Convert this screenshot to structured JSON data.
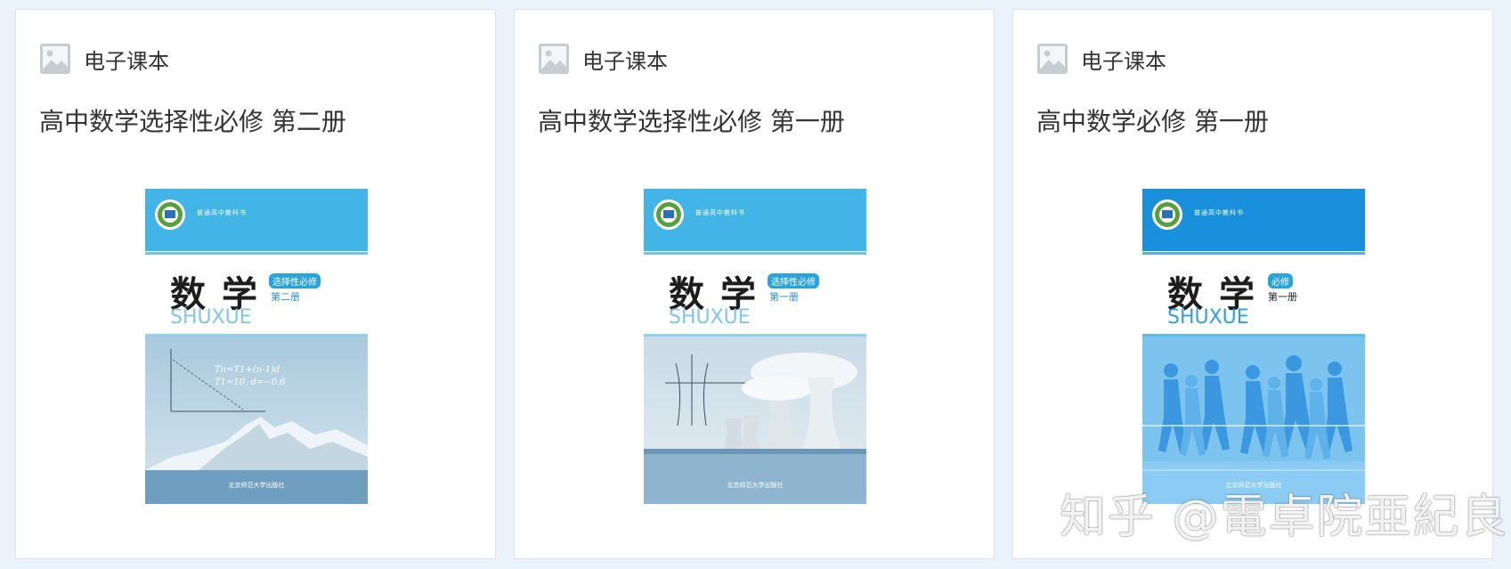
{
  "cards": [
    {
      "type_label": "电子课本",
      "title": "高中数学选择性必修 第二册",
      "cover": {
        "series": "普通高中教科书",
        "subject": "数学",
        "pinyin": "SHUXUE",
        "badge": "选择性必修",
        "volume": "第二册",
        "formula_1": "Tn=T1+(n-1)d",
        "formula_2": "T1=10, d=−0.6",
        "publisher": "北京师范大学出版社",
        "top_color": "#43b4e6"
      }
    },
    {
      "type_label": "电子课本",
      "title": "高中数学选择性必修 第一册",
      "cover": {
        "series": "普通高中教科书",
        "subject": "数学",
        "pinyin": "SHUXUE",
        "badge": "选择性必修",
        "volume": "第一册",
        "publisher": "北京师范大学出版社",
        "top_color": "#43b4e6"
      }
    },
    {
      "type_label": "电子课本",
      "title": "高中数学必修 第一册",
      "cover": {
        "series": "普通高中教科书",
        "subject": "数学",
        "pinyin": "SHUXUE",
        "badge": "必修",
        "volume": "第一册",
        "publisher": "北京师范大学出版社",
        "top_color": "#1a8fdc"
      }
    }
  ],
  "watermark": "知乎 @電卓院亜紀良",
  "colors": {
    "page_bg": "#eaf2fb",
    "card_border": "#d9e4f0",
    "cover_blue": "#43b4e6"
  }
}
